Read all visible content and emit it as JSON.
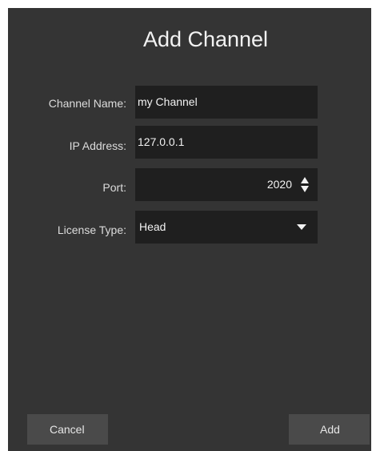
{
  "dialog": {
    "title": "Add Channel"
  },
  "form": {
    "channel_name": {
      "label": "Channel Name:",
      "value": "my Channel"
    },
    "ip_address": {
      "label": "IP Address:",
      "value": "127.0.0.1"
    },
    "port": {
      "label": "Port:",
      "value": "2020"
    },
    "license_type": {
      "label": "License Type:",
      "selected": "Head"
    }
  },
  "buttons": {
    "cancel_label": "Cancel",
    "add_label": "Add"
  },
  "icons": {
    "spin_up": "chevron-up-icon",
    "spin_down": "chevron-down-icon",
    "dropdown": "caret-down-icon"
  },
  "colors": {
    "dialog_background": "#343434",
    "field_background": "#1f1f1f",
    "button_background": "#4a4a4a",
    "text": "#f2f2f2"
  }
}
